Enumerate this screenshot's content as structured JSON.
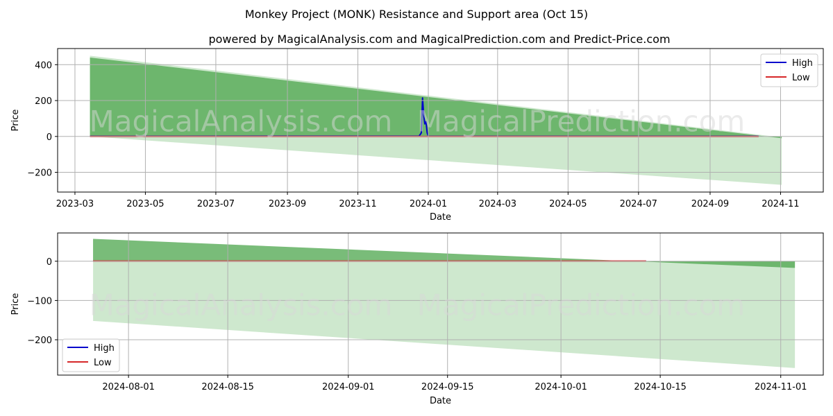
{
  "title": "Monkey Project (MONK) Resistance and Support area (Oct 15)",
  "subtitle": "powered by MagicalAnalysis.com and MagicalPrediction.com and Predict-Price.com",
  "watermarks": [
    "MagicalAnalysis.com",
    "MagicalPrediction.com"
  ],
  "colors": {
    "high": "#0000cc",
    "low": "#d62728",
    "band_dark": "#4ca64c",
    "band_light": "#a5d6a5",
    "grid": "#b0b0b0"
  },
  "chart_data": [
    {
      "type": "area",
      "panel": "top",
      "xlabel": "Date",
      "ylabel": "Price",
      "ylim": [
        -310,
        490
      ],
      "xlim": [
        "2023-02-14",
        "2024-12-08"
      ],
      "grid": true,
      "legend": {
        "position": "top-right",
        "entries": [
          "High",
          "Low"
        ]
      },
      "yticks": [
        400,
        200,
        0,
        -200
      ],
      "ytick_labels": [
        "400",
        "200",
        "0",
        "−200"
      ],
      "xticks": [
        "2023-03-01",
        "2023-05-01",
        "2023-07-01",
        "2023-09-01",
        "2023-11-01",
        "2024-01-01",
        "2024-03-01",
        "2024-05-01",
        "2024-07-01",
        "2024-09-01",
        "2024-11-01"
      ],
      "xtick_labels": [
        "2023-03",
        "2023-05",
        "2023-07",
        "2023-09",
        "2023-11",
        "2024-01",
        "2024-03",
        "2024-05",
        "2024-07",
        "2024-09",
        "2024-11"
      ],
      "bands": [
        {
          "name": "resistance-area",
          "shade": "dark",
          "x": [
            "2023-03-14",
            "2024-11-02"
          ],
          "upper": [
            440,
            -10
          ],
          "lower": [
            0,
            0
          ]
        },
        {
          "name": "support-area",
          "shade": "light",
          "x": [
            "2023-03-14",
            "2024-11-02"
          ],
          "upper": [
            450,
            -5
          ],
          "lower": [
            0,
            -270
          ]
        }
      ],
      "series": [
        {
          "name": "High",
          "color": "#0000cc",
          "x": [
            "2023-03-14",
            "2023-12-24",
            "2023-12-26",
            "2023-12-27",
            "2023-12-28",
            "2023-12-29",
            "2023-12-30",
            "2023-12-31",
            "2024-01-01",
            "2024-10-13"
          ],
          "y": [
            1,
            2,
            20,
            215,
            120,
            70,
            82,
            20,
            1,
            1
          ]
        },
        {
          "name": "Low",
          "color": "#d62728",
          "x": [
            "2023-03-14",
            "2024-10-13"
          ],
          "y": [
            0.5,
            0.5
          ]
        }
      ]
    },
    {
      "type": "area",
      "panel": "bottom",
      "xlabel": "Date",
      "ylabel": "Price",
      "ylim": [
        -290,
        72
      ],
      "xlim": [
        "2024-07-22",
        "2024-11-07"
      ],
      "grid": true,
      "legend": {
        "position": "bottom-left",
        "entries": [
          "High",
          "Low"
        ]
      },
      "yticks": [
        0,
        -100,
        -200
      ],
      "ytick_labels": [
        "0",
        "−100",
        "−200"
      ],
      "xticks": [
        "2024-08-01",
        "2024-08-15",
        "2024-09-01",
        "2024-09-15",
        "2024-10-01",
        "2024-10-15",
        "2024-11-01"
      ],
      "xtick_labels": [
        "2024-08-01",
        "2024-08-15",
        "2024-09-01",
        "2024-09-15",
        "2024-10-01",
        "2024-10-15",
        "2024-11-01"
      ],
      "bands": [
        {
          "name": "resistance-area",
          "shade": "dark",
          "x": [
            "2024-07-27",
            "2024-11-03"
          ],
          "upper": [
            57,
            -17
          ],
          "lower": [
            0,
            0
          ]
        },
        {
          "name": "support-area",
          "shade": "light",
          "x": [
            "2024-07-27",
            "2024-11-03"
          ],
          "upper": [
            0,
            0
          ],
          "lower": [
            -152,
            -272
          ]
        }
      ],
      "series": [
        {
          "name": "High",
          "color": "#0000cc",
          "x": [
            "2024-07-27",
            "2024-10-13"
          ],
          "y": [
            0.5,
            0.5
          ]
        },
        {
          "name": "Low",
          "color": "#d62728",
          "x": [
            "2024-07-27",
            "2024-10-13"
          ],
          "y": [
            0.5,
            0.5
          ]
        }
      ]
    }
  ]
}
